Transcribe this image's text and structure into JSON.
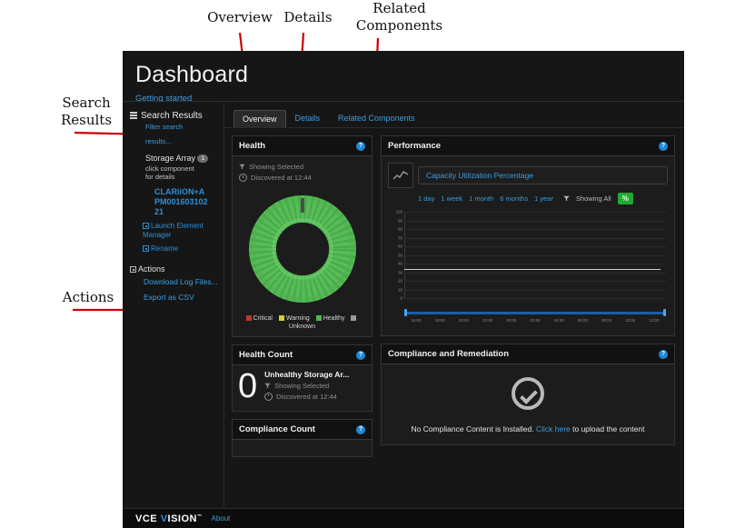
{
  "annotations": [
    {
      "text": "Overview",
      "key": "overview"
    },
    {
      "text": "Details",
      "key": "details"
    },
    {
      "text": "Related\nComponents",
      "key": "related"
    },
    {
      "text": "Search\nResults",
      "key": "search_results"
    },
    {
      "text": "Actions",
      "key": "actions"
    }
  ],
  "header": {
    "title": "Dashboard",
    "getting_started": "Getting started"
  },
  "sidebar": {
    "search_results_title": "Search Results",
    "filter_search": "Filter search",
    "results": "results...",
    "storage_array_label": "Storage Array",
    "storage_array_count": "1",
    "click_component": "click component",
    "for_details": "for details",
    "device_line1": "CLARiiON+A",
    "device_line2": "PM001603102",
    "device_line3": "21",
    "launch_element_manager": "Launch Element Manager",
    "rename": "Rename",
    "actions_title": "Actions",
    "download_log_files": "Download Log Files...",
    "export_as_csv": "Export as CSV"
  },
  "tabs": [
    {
      "label": "Overview",
      "active": true
    },
    {
      "label": "Details",
      "active": false
    },
    {
      "label": "Related Components",
      "active": false
    }
  ],
  "health_panel": {
    "title": "Health",
    "help": "?",
    "showing_selected": "Showing Selected",
    "discovered_at": "Discovered at 12:44",
    "unknown_label": "Unknown",
    "legend": [
      {
        "label": "Critical",
        "color": "#c0392b"
      },
      {
        "label": "Warning",
        "color": "#d6cf2a"
      },
      {
        "label": "Healthy",
        "color": "#4fb74f"
      },
      {
        "label": "",
        "color": "#9a9a9a"
      }
    ]
  },
  "health_count_panel": {
    "title": "Health Count",
    "help": "?",
    "count": "0",
    "label": "Unhealthy Storage Ar...",
    "showing_selected": "Showing Selected",
    "discovered_at": "Discovered at 12:44"
  },
  "compliance_count_panel": {
    "title": "Compliance Count",
    "help": "?"
  },
  "performance_panel": {
    "title": "Performance",
    "help": "?",
    "metric": "Capacity Utilization Percentage",
    "ranges": [
      "1 day",
      "1 week",
      "1 month",
      "6 months",
      "1 year"
    ],
    "showing_all": "Showing All",
    "unit_button": "%"
  },
  "compliance_panel": {
    "title": "Compliance and Remediation",
    "help": "?",
    "message_before": "No Compliance Content is Installed. ",
    "link": "Click here",
    "message_after": " to upload the content"
  },
  "footer": {
    "logo_vce": "VCE ",
    "logo_v": "V",
    "logo_ision": "ISION",
    "logo_tm": "™",
    "about": "About"
  },
  "chart_data": {
    "type": "line",
    "title": "Capacity Utilization Percentage",
    "xlabel": "",
    "ylabel": "",
    "ylim": [
      0,
      100
    ],
    "yticks": [
      0,
      10,
      20,
      30,
      40,
      50,
      60,
      70,
      80,
      90,
      100
    ],
    "x": [
      "16:00",
      "18:00",
      "20:00",
      "22:00",
      "00:00",
      "02:00",
      "04:00",
      "06:00",
      "08:00",
      "10:00",
      "12:00"
    ],
    "series": [
      {
        "name": "Capacity Utilization Percentage",
        "values": [
          34,
          34,
          34,
          34,
          34,
          34,
          34,
          34,
          34,
          34,
          34
        ],
        "color": "#c9c9c9"
      }
    ],
    "grid": true,
    "legend_position": "none"
  },
  "donut_data": {
    "type": "pie",
    "title": "Health",
    "categories": [
      "Critical",
      "Warning",
      "Healthy",
      "Unknown"
    ],
    "values": [
      0,
      0,
      100,
      0
    ],
    "colors": [
      "#c0392b",
      "#d6cf2a",
      "#4fb74f",
      "#9a9a9a"
    ]
  }
}
